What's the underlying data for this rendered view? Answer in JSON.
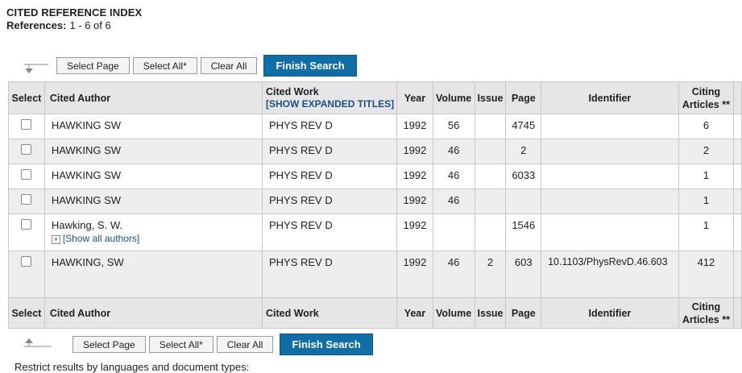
{
  "header": {
    "title": "CITED REFERENCE INDEX",
    "refs_label": "References:",
    "refs_value": "1 - 6 of 6"
  },
  "toolbar": {
    "select_page": "Select Page",
    "select_all": "Select All*",
    "clear_all": "Clear All",
    "finish_search": "Finish Search"
  },
  "columns": {
    "select": "Select",
    "cited_author": "Cited Author",
    "cited_work": "Cited Work",
    "show_expanded": "[SHOW EXPANDED TITLES]",
    "year": "Year",
    "volume": "Volume",
    "issue": "Issue",
    "page": "Page",
    "identifier": "Identifier",
    "citing_articles": "Citing Articles **"
  },
  "rows": [
    {
      "author": "HAWKING SW",
      "work": "PHYS REV D",
      "year": "1992",
      "volume": "56",
      "issue": "",
      "page": "4745",
      "identifier": "",
      "citing": "6"
    },
    {
      "author": "HAWKING SW",
      "work": "PHYS REV D",
      "year": "1992",
      "volume": "46",
      "issue": "",
      "page": "2",
      "identifier": "",
      "citing": "2"
    },
    {
      "author": "HAWKING SW",
      "work": "PHYS REV D",
      "year": "1992",
      "volume": "46",
      "issue": "",
      "page": "6033",
      "identifier": "",
      "citing": "1"
    },
    {
      "author": "HAWKING SW",
      "work": "PHYS REV D",
      "year": "1992",
      "volume": "46",
      "issue": "",
      "page": "",
      "identifier": "",
      "citing": "1"
    },
    {
      "author": "Hawking, S. W.",
      "show_all_authors": "[Show all authors]",
      "work": "PHYS REV D",
      "year": "1992",
      "volume": "",
      "issue": "",
      "page": "1546",
      "identifier": "",
      "citing": "1"
    },
    {
      "author": "HAWKING, SW",
      "work": "PHYS REV D",
      "year": "1992",
      "volume": "46",
      "issue": "2",
      "page": "603",
      "identifier": "10.1103/PhysRevD.46.603",
      "citing": "412"
    }
  ],
  "footer_text": "Restrict results by languages and document types:"
}
